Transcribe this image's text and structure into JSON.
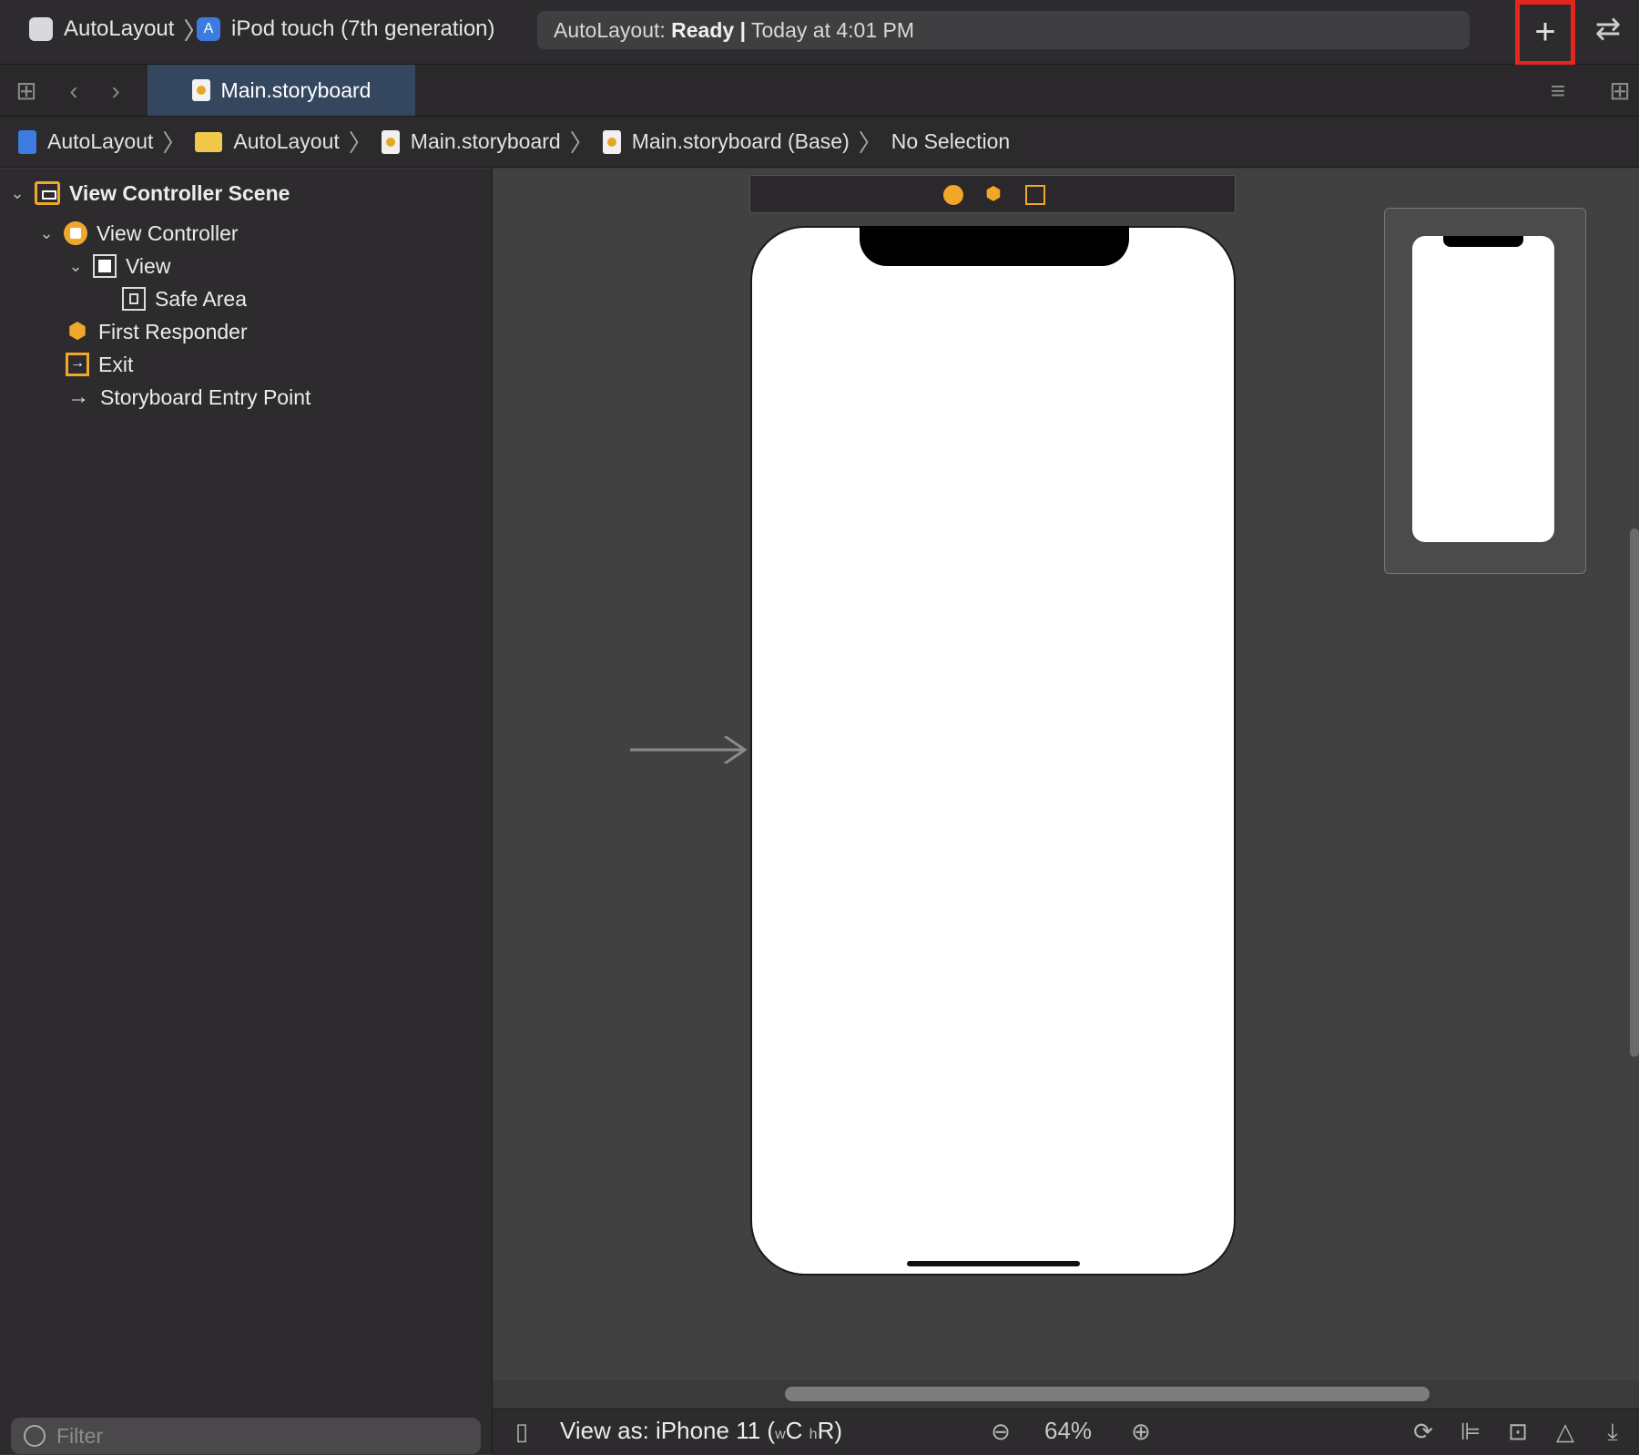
{
  "toolbar": {
    "scheme_app": "AutoLayout",
    "scheme_device": "iPod touch (7th generation)",
    "status_prefix": "AutoLayout:",
    "status_state": "Ready",
    "status_sep": "|",
    "status_time": "Today at 4:01 PM",
    "plus_glyph": "+",
    "swap_glyph": "⇄"
  },
  "tabs": {
    "main_tab": "Main.storyboard"
  },
  "breadcrumb": {
    "project": "AutoLayout",
    "folder": "AutoLayout",
    "file": "Main.storyboard",
    "base": "Main.storyboard (Base)",
    "selection": "No Selection"
  },
  "outline": {
    "scene": "View Controller Scene",
    "view_controller": "View Controller",
    "view": "View",
    "safe_area": "Safe Area",
    "first_responder": "First Responder",
    "exit": "Exit",
    "entry_point": "Storyboard Entry Point"
  },
  "filter": {
    "placeholder": "Filter"
  },
  "bottom": {
    "view_as_label": "View as: iPhone 11 (",
    "w_small": "w",
    "w_val": "C",
    "h_small": "h",
    "h_val": "R)",
    "zoom": "64%"
  },
  "colors": {
    "accent_orange": "#f0a72a",
    "highlight_red": "#e5261f",
    "tab_active": "#34475f"
  }
}
